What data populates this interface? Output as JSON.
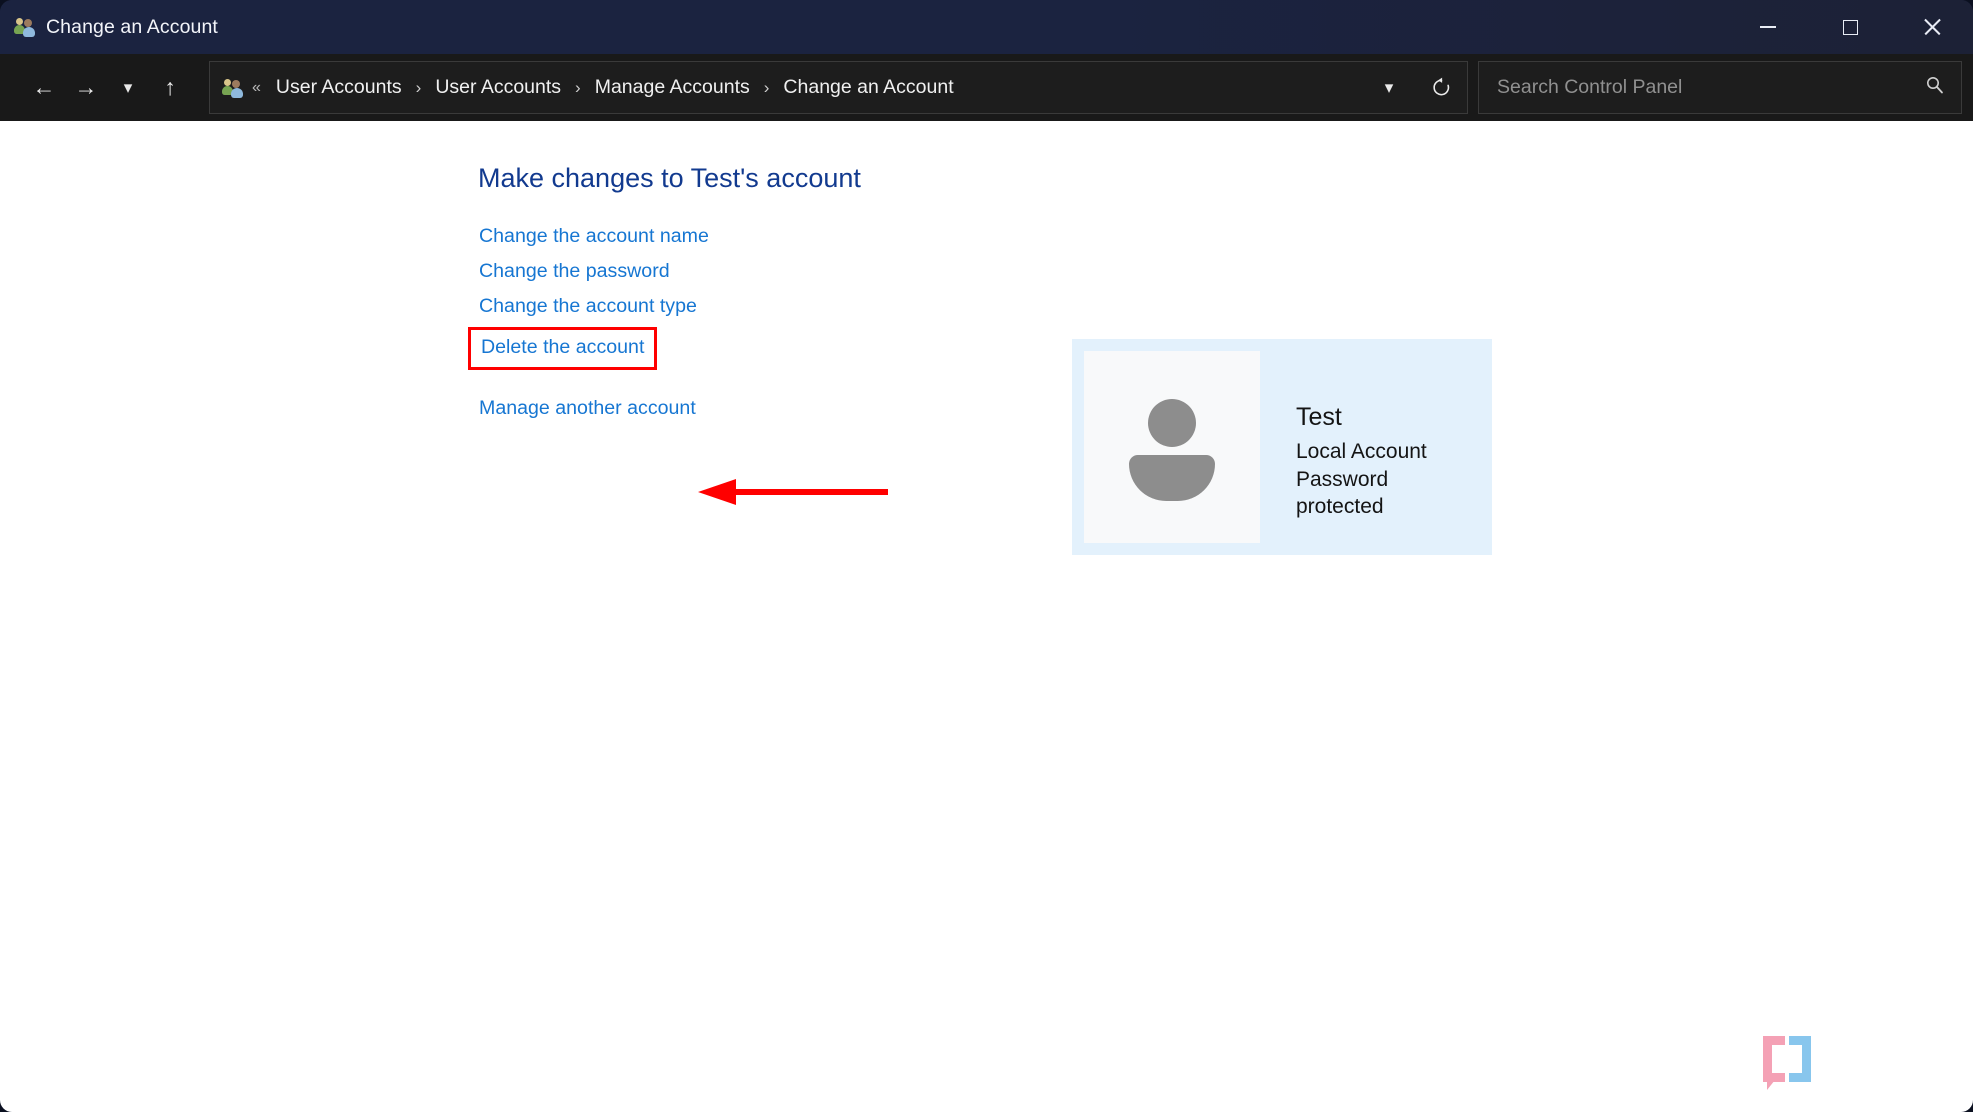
{
  "window": {
    "title": "Change an Account",
    "title_icon": "user-accounts-icon",
    "controls": {
      "minimize": "Minimize",
      "maximize": "Maximize",
      "close": "Close"
    }
  },
  "navbar": {
    "back": "←",
    "forward": "→",
    "recent": "⌄",
    "up": "↑",
    "breadcrumb_icon": "user-accounts-icon",
    "overflow": "«",
    "crumbs": [
      "User Accounts",
      "User Accounts",
      "Manage Accounts",
      "Change an Account"
    ],
    "separator": "›",
    "dropdown": "⌄",
    "refresh": "⟳",
    "refresh_label": "Refresh"
  },
  "search": {
    "placeholder": "Search Control Panel",
    "value": "",
    "icon": "search-icon"
  },
  "main": {
    "heading": "Make changes to Test's account",
    "links": [
      {
        "label": "Change the account name",
        "highlighted": false
      },
      {
        "label": "Change the password",
        "highlighted": false
      },
      {
        "label": "Change the account type",
        "highlighted": false
      },
      {
        "label": "Delete the account",
        "highlighted": true
      }
    ],
    "secondary_link": {
      "label": "Manage another account"
    }
  },
  "account_card": {
    "avatar_icon": "user-avatar-icon",
    "name": "Test",
    "account_type": "Local Account",
    "password_status": "Password protected"
  },
  "annotation": {
    "arrow": "red-left-arrow",
    "target": "Delete the account",
    "color": "#ff0000"
  },
  "watermark": {
    "text": "XDA",
    "bracket_left_color": "#f49ab0",
    "bracket_right_color": "#7fc2ec"
  },
  "colors": {
    "titlebar": "#1b2340",
    "navbar": "#191919",
    "content_bg": "#ffffff",
    "heading": "#123a8f",
    "link": "#1676d2",
    "card_bg": "#e3f1fc",
    "avatar_tile": "#f8f9fa",
    "annotation": "#ff0000"
  }
}
